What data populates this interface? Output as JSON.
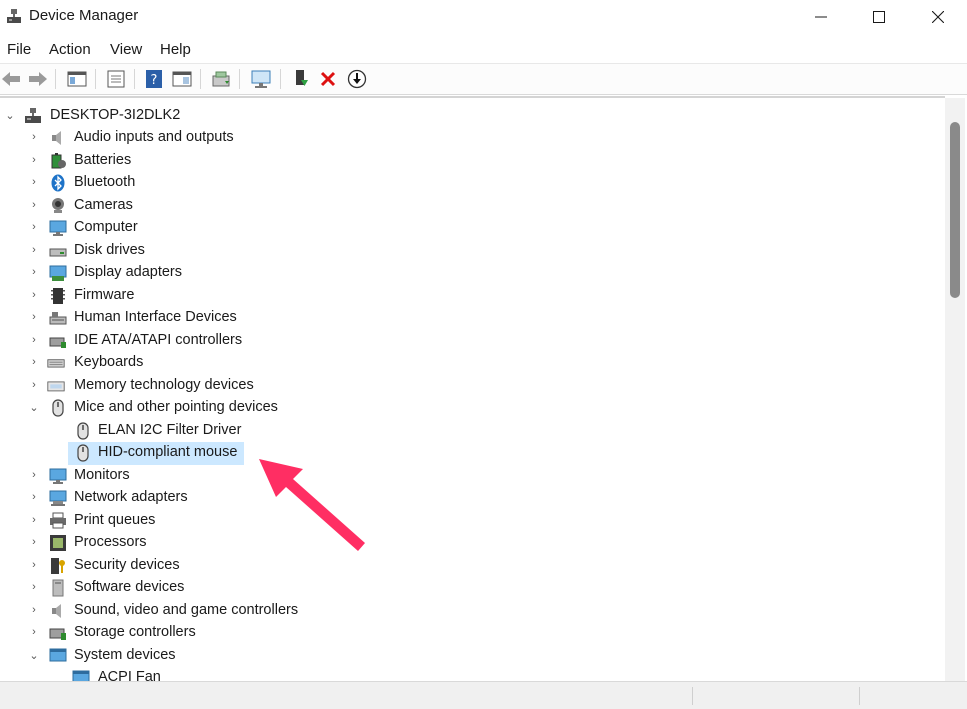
{
  "window": {
    "title": "Device Manager",
    "controls": [
      "minimize",
      "maximize",
      "close"
    ]
  },
  "menu": {
    "items": [
      "File",
      "Action",
      "View",
      "Help"
    ]
  },
  "toolbar": {
    "icons": [
      "back-arrow-icon",
      "forward-arrow-icon",
      "show-hide-console-tree-icon",
      "properties-icon",
      "help-icon",
      "action-pane-icon",
      "update-driver-icon",
      "scan-hardware-icon",
      "enable-device-icon",
      "uninstall-device-icon",
      "download-driver-icon"
    ]
  },
  "tree": {
    "root": "DESKTOP-3I2DLK2",
    "items": [
      {
        "label": "Audio inputs and outputs",
        "icon": "speaker-icon"
      },
      {
        "label": "Batteries",
        "icon": "battery-icon"
      },
      {
        "label": "Bluetooth",
        "icon": "bluetooth-icon"
      },
      {
        "label": "Cameras",
        "icon": "camera-icon"
      },
      {
        "label": "Computer",
        "icon": "computer-icon"
      },
      {
        "label": "Disk drives",
        "icon": "disk-drive-icon"
      },
      {
        "label": "Display adapters",
        "icon": "display-adapter-icon"
      },
      {
        "label": "Firmware",
        "icon": "firmware-icon"
      },
      {
        "label": "Human Interface Devices",
        "icon": "hid-icon"
      },
      {
        "label": "IDE ATA/ATAPI controllers",
        "icon": "ide-controller-icon"
      },
      {
        "label": "Keyboards",
        "icon": "keyboard-icon"
      },
      {
        "label": "Memory technology devices",
        "icon": "memory-icon"
      },
      {
        "label": "Mice and other pointing devices",
        "icon": "mouse-icon",
        "expanded": true
      },
      {
        "label": "Monitors",
        "icon": "monitor-icon"
      },
      {
        "label": "Network adapters",
        "icon": "network-adapter-icon"
      },
      {
        "label": "Print queues",
        "icon": "printer-icon"
      },
      {
        "label": "Processors",
        "icon": "processor-icon"
      },
      {
        "label": "Security devices",
        "icon": "security-icon"
      },
      {
        "label": "Software devices",
        "icon": "software-device-icon"
      },
      {
        "label": "Sound, video and game controllers",
        "icon": "speaker-icon"
      },
      {
        "label": "Storage controllers",
        "icon": "storage-controller-icon"
      },
      {
        "label": "System devices",
        "icon": "system-devices-icon",
        "expanded": true
      }
    ],
    "mice_children": [
      "ELAN I2C Filter Driver",
      "HID-compliant mouse"
    ],
    "system_children": [
      "ACPI Fan"
    ],
    "selected": "HID-compliant mouse"
  },
  "colors": {
    "selection": "#cce8ff",
    "annotation_arrow": "#ff2e63",
    "accent_blue": "#1e73c8"
  }
}
